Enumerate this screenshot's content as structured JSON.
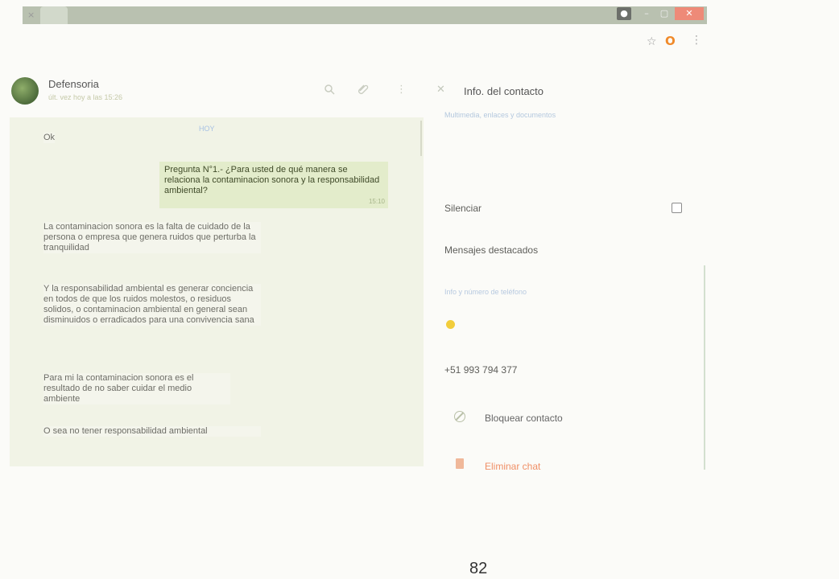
{
  "browser": {
    "tab_close_glyph": "×",
    "window_min_glyph": "–",
    "window_max_glyph": "▢",
    "window_close_glyph": "✕",
    "star_glyph": "☆",
    "opera_glyph": "O",
    "menu_glyph": "⋮"
  },
  "chat_header": {
    "contact_name": "Defensoria",
    "status": "últ. vez hoy a las 15:26",
    "icons": [
      "search-icon",
      "attach-icon",
      "menu-icon"
    ]
  },
  "chat": {
    "day_label": "HOY",
    "messages": [
      {
        "direction": "in",
        "text": "Ok"
      },
      {
        "direction": "out",
        "text": "Pregunta N°1.- ¿Para usted de qué manera se relaciona la contaminacion sonora y la responsabilidad ambiental?",
        "time": "15:10"
      },
      {
        "direction": "in",
        "text": "La contaminacion sonora es la falta de cuidado de la persona o empresa que genera ruidos que perturba la tranquilidad"
      },
      {
        "direction": "in",
        "text": "Y la responsabilidad ambiental es generar conciencia en todos de que los ruidos molestos, o residuos solidos, o contaminacion ambiental en general sean disminuidos o erradicados para una convivencia sana"
      },
      {
        "direction": "in",
        "text": "Para mi la contaminacion sonora es el resultado de no saber cuidar el medio ambiente"
      },
      {
        "direction": "in",
        "text": "O sea no tener responsabilidad ambiental"
      }
    ]
  },
  "contact_info": {
    "close_glyph": "✕",
    "title": "Info. del contacto",
    "media_link": "Multimedia, enlaces y documentos",
    "mute_label": "Silenciar",
    "starred_label": "Mensajes destacados",
    "about_label": "Info y número de teléfono",
    "phone": "+51 993 794 377",
    "block_label": "Bloquear contacto",
    "delete_label": "Eliminar chat"
  },
  "page_number": "82",
  "colors": {
    "chat_bg": "#f1f3e6",
    "outgoing_bubble": "#e3eccb",
    "delete_accent": "#f08f66",
    "window_close": "#ee8a78"
  }
}
